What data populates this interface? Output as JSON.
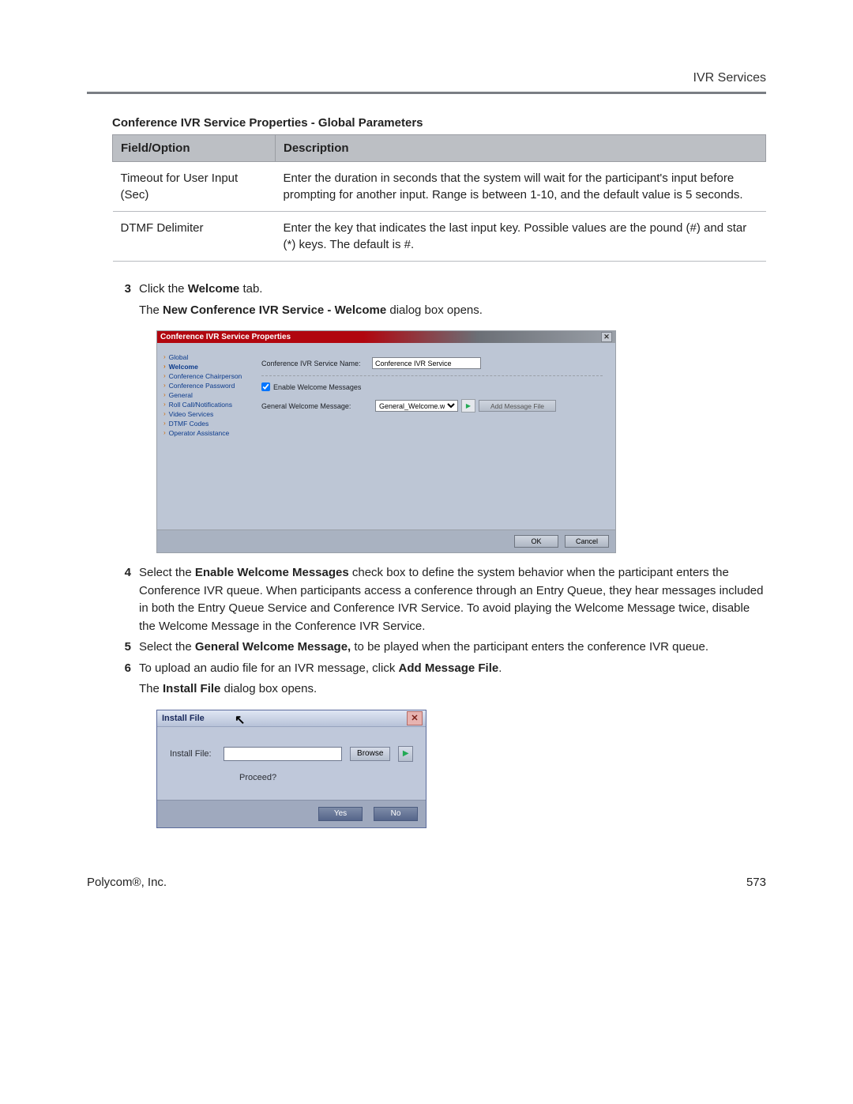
{
  "header": {
    "section": "IVR Services"
  },
  "table": {
    "caption": "Conference IVR Service Properties - Global Parameters",
    "headers": [
      "Field/Option",
      "Description"
    ],
    "rows": [
      {
        "field": "Timeout for User Input (Sec)",
        "desc": "Enter the duration in seconds that the system will wait for the participant's input before prompting for another input. Range is between 1-10, and the default value is 5 seconds."
      },
      {
        "field": "DTMF Delimiter",
        "desc": "Enter the key that indicates the last input key. Possible values are the pound (#) and star (*) keys. The default is #."
      }
    ]
  },
  "steps": {
    "s3_num": "3",
    "s3_a": "Click the ",
    "s3_b": "Welcome",
    "s3_c": " tab.",
    "s3_sub_a": "The ",
    "s3_sub_b": "New Conference IVR Service - Welcome",
    "s3_sub_c": " dialog box opens.",
    "s4_num": "4",
    "s4_a": "Select the ",
    "s4_b": "Enable Welcome Messages",
    "s4_c": " check box to define the system behavior when the participant enters the Conference IVR queue. When participants access a conference through an Entry Queue, they hear messages included in both the Entry Queue Service and Conference IVR Service. To avoid playing the Welcome Message twice, disable the Welcome Message in the Conference IVR Service.",
    "s5_num": "5",
    "s5_a": "Select the ",
    "s5_b": "General Welcome Message,",
    "s5_c": " to be played when the participant enters the conference IVR queue.",
    "s6_num": "6",
    "s6_a": "To upload an audio file for an IVR message, click ",
    "s6_b": "Add Message File",
    "s6_c": ".",
    "s6_sub_a": "The ",
    "s6_sub_b": "Install File",
    "s6_sub_c": " dialog box opens."
  },
  "dialog1": {
    "title": "Conference IVR Service Properties",
    "nav": [
      "Global",
      "Welcome",
      "Conference Chairperson",
      "Conference Password",
      "General",
      "Roll Call/Notifications",
      "Video Services",
      "DTMF Codes",
      "Operator Assistance"
    ],
    "active_nav_index": 1,
    "service_name_label": "Conference IVR Service Name:",
    "service_name_value": "Conference IVR Service",
    "enable_label": "Enable Welcome Messages",
    "enable_checked": true,
    "gwm_label": "General Welcome Message:",
    "gwm_value": "General_Welcome.wav",
    "add_msg_btn": "Add Message File",
    "ok_btn": "OK",
    "cancel_btn": "Cancel"
  },
  "dialog2": {
    "title": "Install File",
    "install_label": "Install File:",
    "install_value": "",
    "browse_btn": "Browse",
    "proceed_label": "Proceed?",
    "yes_btn": "Yes",
    "no_btn": "No"
  },
  "footer": {
    "left": "Polycom®, Inc.",
    "right": "573"
  }
}
